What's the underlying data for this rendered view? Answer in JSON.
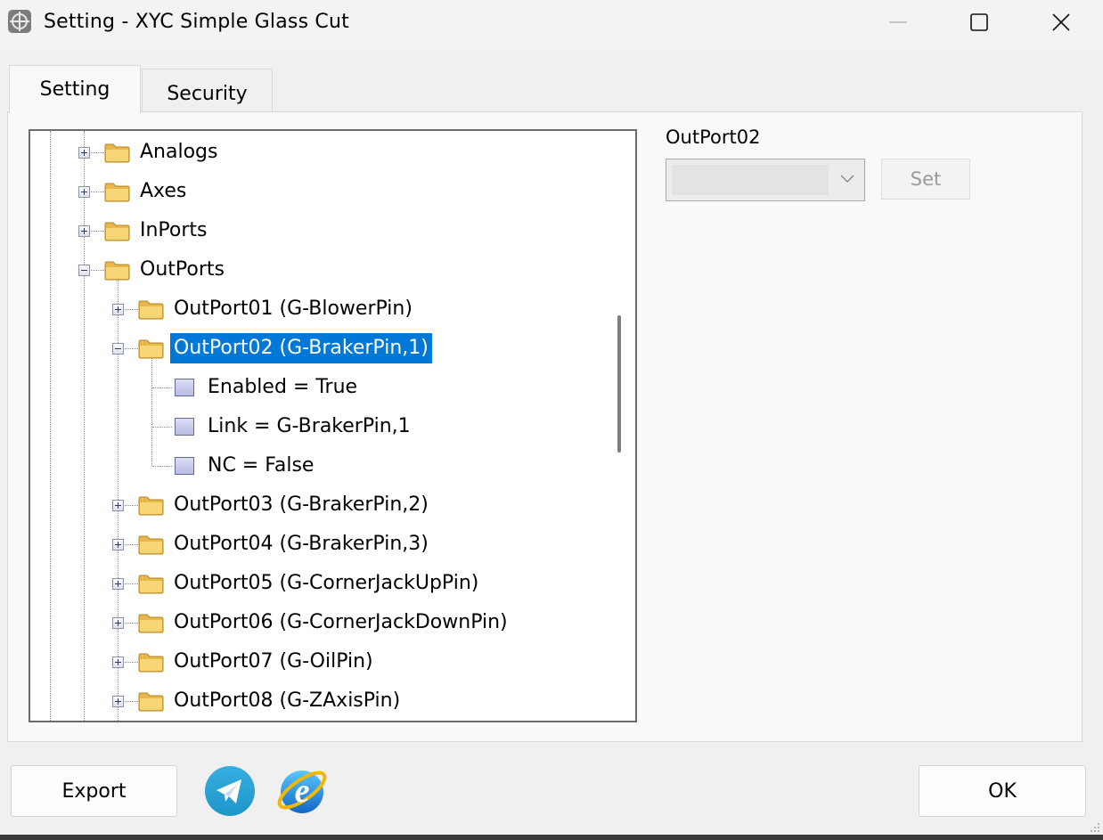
{
  "window": {
    "title": "Setting - XYC Simple Glass Cut",
    "controls": [
      "minimize",
      "maximize",
      "close"
    ]
  },
  "tabs": [
    {
      "label": "Setting",
      "active": true
    },
    {
      "label": "Security",
      "active": false
    }
  ],
  "tree": {
    "nodes": [
      {
        "label": "Analogs",
        "type": "folder",
        "expanded": false
      },
      {
        "label": "Axes",
        "type": "folder",
        "expanded": false
      },
      {
        "label": "InPorts",
        "type": "folder",
        "expanded": false
      },
      {
        "label": "OutPorts",
        "type": "folder",
        "expanded": true
      },
      {
        "label": "OutPort01 (G-BlowerPin)",
        "type": "folder",
        "expanded": false
      },
      {
        "label": "OutPort02 (G-BrakerPin,1)",
        "type": "folder",
        "expanded": true,
        "selected": true
      },
      {
        "label": "Enabled = True",
        "type": "property"
      },
      {
        "label": "Link = G-BrakerPin,1",
        "type": "property"
      },
      {
        "label": "NC = False",
        "type": "property"
      },
      {
        "label": "OutPort03 (G-BrakerPin,2)",
        "type": "folder",
        "expanded": false
      },
      {
        "label": "OutPort04 (G-BrakerPin,3)",
        "type": "folder",
        "expanded": false
      },
      {
        "label": "OutPort05 (G-CornerJackUpPin)",
        "type": "folder",
        "expanded": false
      },
      {
        "label": "OutPort06 (G-CornerJackDownPin)",
        "type": "folder",
        "expanded": false
      },
      {
        "label": "OutPort07 (G-OilPin)",
        "type": "folder",
        "expanded": false
      },
      {
        "label": "OutPort08 (G-ZAxisPin)",
        "type": "folder",
        "expanded": false
      }
    ]
  },
  "property_panel": {
    "label": "OutPort02",
    "combo_value": "",
    "set_label": "Set"
  },
  "footer": {
    "export_label": "Export",
    "ok_label": "OK",
    "icons": [
      "telegram-icon",
      "internet-explorer-icon"
    ]
  },
  "colors": {
    "selection": "#0078d7",
    "window_bg": "#f0f0f0",
    "tree_bg": "#ffffff"
  }
}
